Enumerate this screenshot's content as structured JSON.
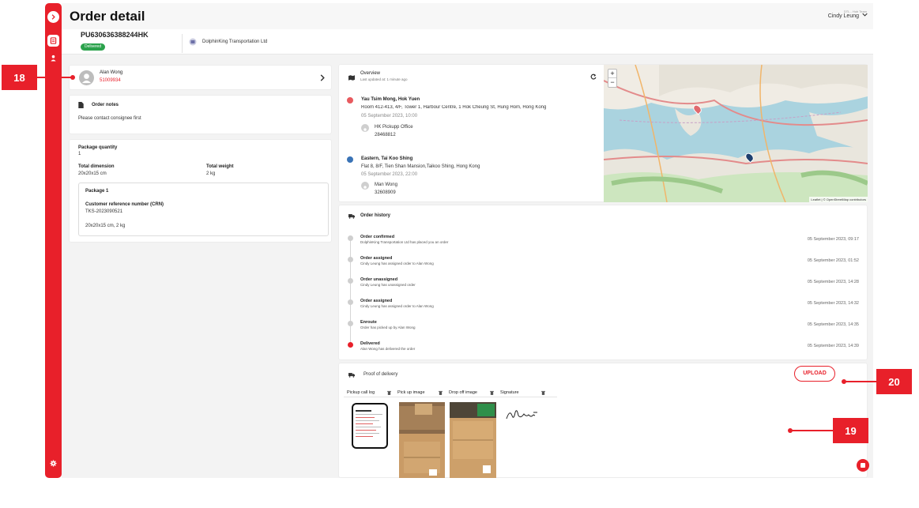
{
  "page": {
    "title": "Order detail",
    "user_org": "DTL - Hub Team",
    "user_name": "Cindy Leung"
  },
  "order": {
    "number": "PU630636388244HK",
    "status": "Delivered",
    "company": "DolphinKing Transportation Ltd"
  },
  "driver": {
    "name": "Alan Wong",
    "phone": "51009934"
  },
  "order_notes": {
    "title": "Order notes",
    "text": "Please contact consignee first"
  },
  "package_summary": {
    "quantity_label": "Package quantity",
    "quantity": "1",
    "dimension_label": "Total dimension",
    "dimension": "20x20x15 cm",
    "weight_label": "Total weight",
    "weight": "2 kg",
    "package_title": "Package 1",
    "crn_label": "Customer reference number (CRN)",
    "crn": "TKS-2023090521",
    "package_detail": "20x20x15 cm, 2 kg"
  },
  "overview": {
    "title": "Overview",
    "updated": "Last updated at: 1 minute ago",
    "pickup": {
      "area": "Yau Tsim Mong, Hok Yuen",
      "address": "Room 412-413, 4/F, Tower 1, Harbour Centre, 1 Hok Cheung St, Hung Hom, Hong Kong",
      "time": "05 September 2023, 10:00",
      "contact_name": "HK Pickupp Office",
      "contact_phone": "28468812"
    },
    "dropoff": {
      "area": "Eastern, Tai Koo Shing",
      "address": "Flat 8, 8/F, Tien Shan Mansion,Taikoo Shing, Hong Kong",
      "time": "05 September 2023, 22:00",
      "contact_name": "Man Wong",
      "contact_phone": "32608909"
    },
    "map_attribution": "Leaflet | © OpenStreetMap contributors",
    "zoom_in": "+",
    "zoom_out": "−"
  },
  "history": {
    "title": "Order history",
    "events": [
      {
        "title": "Order confirmed",
        "desc": "DolphinKing Transportation Ltd has placed you an order",
        "time": "05 September 2023, 09:17"
      },
      {
        "title": "Order assigned",
        "desc": "Cindy Leung has assigned order to Alan Wong",
        "time": "05 September 2023, 01:52"
      },
      {
        "title": "Order unassigned",
        "desc": "Cindy Leung has unassigned order",
        "time": "05 September 2023, 14:28"
      },
      {
        "title": "Order assigned",
        "desc": "Cindy Leung has assigned order to Alan Wong",
        "time": "05 September 2023, 14:32"
      },
      {
        "title": "Enroute",
        "desc": "Order has picked up by Alan Wong",
        "time": "05 September 2023, 14:35"
      },
      {
        "title": "Delivered",
        "desc": "Alan Wong has delivered the order",
        "time": "05 September 2023, 14:39"
      }
    ]
  },
  "proof": {
    "title": "Proof of delivery",
    "upload": "UPLOAD",
    "columns": [
      "Pickup call log",
      "Pick up image",
      "Drop off image",
      "Signature"
    ]
  },
  "annotations": {
    "a18": "18",
    "a19": "19",
    "a20": "20"
  },
  "colors": {
    "brand_red": "#e8202a",
    "status_green": "#2ba24c"
  }
}
